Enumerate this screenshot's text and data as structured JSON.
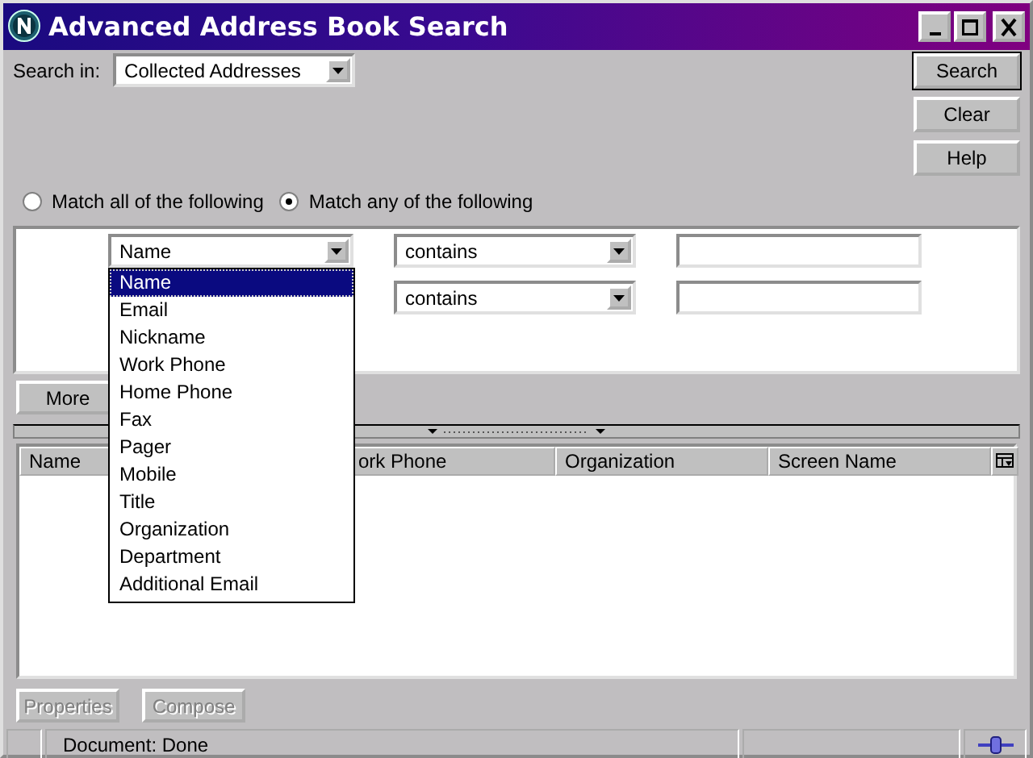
{
  "window": {
    "title": "Advanced Address Book Search"
  },
  "search_in": {
    "label": "Search in:",
    "value": "Collected Addresses"
  },
  "side_buttons": [
    {
      "label": "Search",
      "default": true
    },
    {
      "label": "Clear",
      "default": false
    },
    {
      "label": "Help",
      "default": false
    }
  ],
  "match_options": [
    {
      "label": "Match all of the following",
      "selected": false
    },
    {
      "label": "Match any of the following",
      "selected": true
    }
  ],
  "criteria": [
    {
      "field": "Name",
      "operator": "contains"
    },
    {
      "operator": "contains"
    }
  ],
  "field_menu": [
    {
      "label": "Name",
      "selected": true
    },
    {
      "label": "Email",
      "selected": false
    },
    {
      "label": "Nickname",
      "selected": false
    },
    {
      "label": "Work Phone",
      "selected": false
    },
    {
      "label": "Home Phone",
      "selected": false
    },
    {
      "label": "Fax",
      "selected": false
    },
    {
      "label": "Pager",
      "selected": false
    },
    {
      "label": "Mobile",
      "selected": false
    },
    {
      "label": "Title",
      "selected": false
    },
    {
      "label": "Organization",
      "selected": false
    },
    {
      "label": "Department",
      "selected": false
    },
    {
      "label": "Additional Email",
      "selected": false
    }
  ],
  "more_button": "More",
  "results": {
    "columns": [
      "Name",
      "ork Phone",
      "Organization",
      "Screen Name"
    ]
  },
  "bottom_buttons": [
    {
      "label": "Properties",
      "disabled": true
    },
    {
      "label": "Compose",
      "disabled": true
    }
  ],
  "status_bar": {
    "text": "Document: Done"
  }
}
